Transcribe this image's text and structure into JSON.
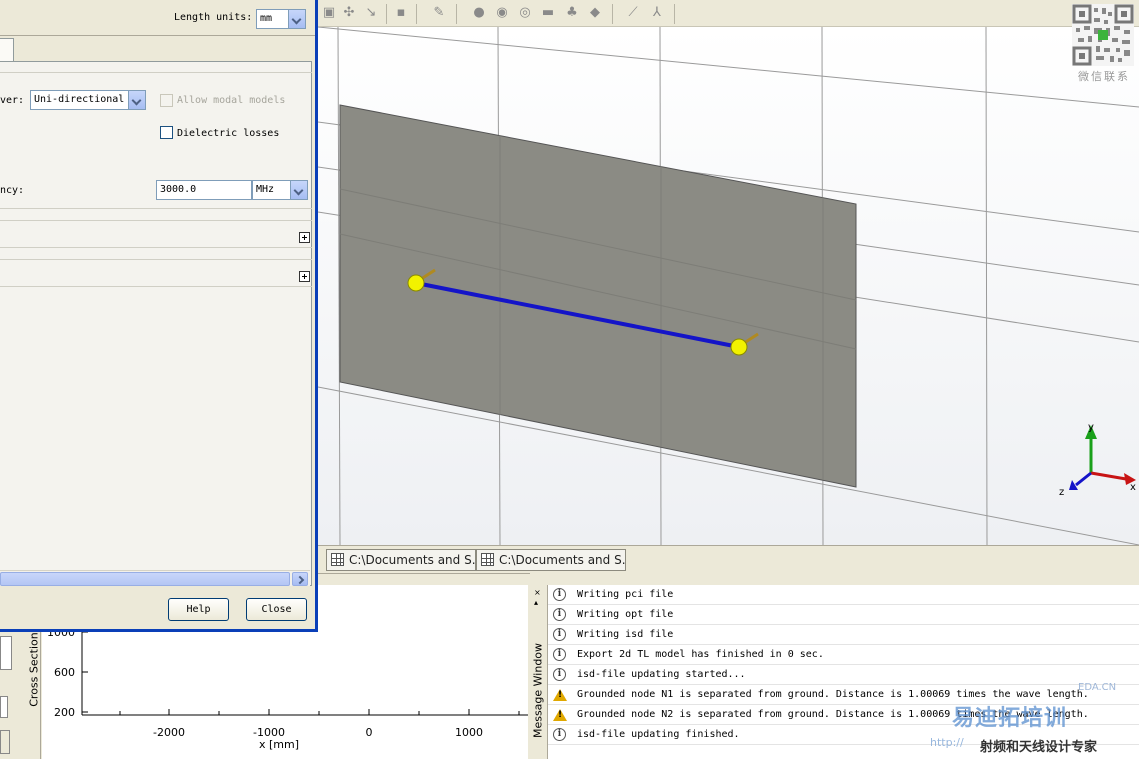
{
  "dialog": {
    "length_units_label": "Length units:",
    "length_units_value": "mm",
    "solver_label": "ver:",
    "solver_value": "Uni-directional",
    "allow_modal_label": "Allow modal models",
    "dielectric_losses_label": "Dielectric losses",
    "frequency_label": "ncy:",
    "frequency_value": "3000.0",
    "frequency_unit": "MHz",
    "help_label": "Help",
    "close_label": "Close"
  },
  "tabs": [
    {
      "label": "C:\\Documents and S..."
    },
    {
      "label": "C:\\Documents and S..."
    }
  ],
  "viewport": {
    "axes": {
      "x": "x",
      "y": "y",
      "z": "z"
    },
    "colors": {
      "plane": "#8a8a82",
      "line": "#1414c8",
      "port": "#f0f000",
      "grid": "#9a9a9a"
    }
  },
  "cross_section": {
    "panel_label": "Cross Section",
    "x_ticks": [
      "-2000",
      "-1000",
      "0",
      "1000"
    ],
    "y_ticks": [
      "1000",
      "600",
      "200"
    ],
    "x_axis_label": "x [mm]"
  },
  "message_window": {
    "panel_label": "Message Window",
    "messages": [
      {
        "type": "info",
        "text": " Writing pci file"
      },
      {
        "type": "info",
        "text": " Writing opt file"
      },
      {
        "type": "info",
        "text": " Writing isd file"
      },
      {
        "type": "info",
        "text": "Export 2d TL model has finished in 0 sec."
      },
      {
        "type": "info",
        "text": "isd-file updating started..."
      },
      {
        "type": "warning",
        "text": "Grounded node N1 is separated from ground. Distance is 1.00069 times the wave length."
      },
      {
        "type": "warning",
        "text": "Grounded node N2 is separated from ground. Distance is 1.00069 times the wave length."
      },
      {
        "type": "info",
        "text": "isd-file updating finished."
      }
    ]
  },
  "watermark": {
    "qr_caption": "微信联系",
    "brand": "易迪拓培训",
    "slogan": "射频和天线设计专家",
    "site": "EDA.CN",
    "url": "http://"
  }
}
